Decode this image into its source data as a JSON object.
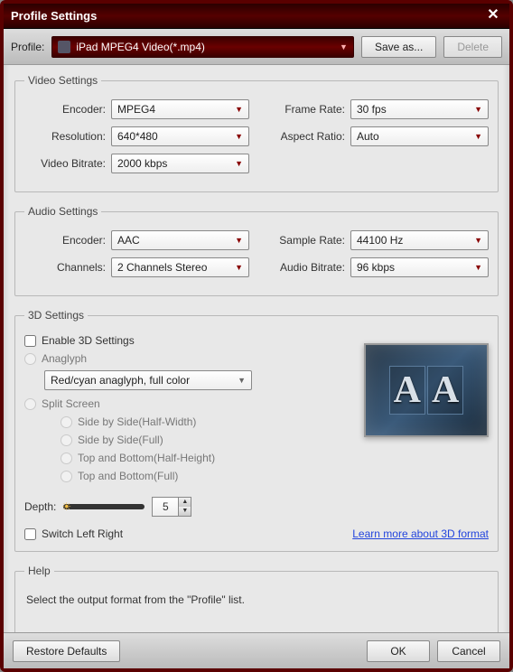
{
  "title": "Profile Settings",
  "toolbar": {
    "profile_label": "Profile:",
    "profile_value": "iPad MPEG4 Video(*.mp4)",
    "save_as": "Save as...",
    "delete": "Delete"
  },
  "video": {
    "legend": "Video Settings",
    "encoder_label": "Encoder:",
    "encoder_value": "MPEG4",
    "framerate_label": "Frame Rate:",
    "framerate_value": "30 fps",
    "resolution_label": "Resolution:",
    "resolution_value": "640*480",
    "aspect_label": "Aspect Ratio:",
    "aspect_value": "Auto",
    "bitrate_label": "Video Bitrate:",
    "bitrate_value": "2000 kbps"
  },
  "audio": {
    "legend": "Audio Settings",
    "encoder_label": "Encoder:",
    "encoder_value": "AAC",
    "samplerate_label": "Sample Rate:",
    "samplerate_value": "44100 Hz",
    "channels_label": "Channels:",
    "channels_value": "2 Channels Stereo",
    "bitrate_label": "Audio Bitrate:",
    "bitrate_value": "96 kbps"
  },
  "threed": {
    "legend": "3D Settings",
    "enable": "Enable 3D Settings",
    "anaglyph": "Anaglyph",
    "anaglyph_value": "Red/cyan anaglyph, full color",
    "split": "Split Screen",
    "sbs_half": "Side by Side(Half-Width)",
    "sbs_full": "Side by Side(Full)",
    "tb_half": "Top and Bottom(Half-Height)",
    "tb_full": "Top and Bottom(Full)",
    "depth_label": "Depth:",
    "depth_value": "5",
    "switch_lr": "Switch Left Right",
    "learn_link": "Learn more about 3D format"
  },
  "help": {
    "legend": "Help",
    "text": "Select the output format from the \"Profile\" list."
  },
  "footer": {
    "restore": "Restore Defaults",
    "ok": "OK",
    "cancel": "Cancel"
  }
}
